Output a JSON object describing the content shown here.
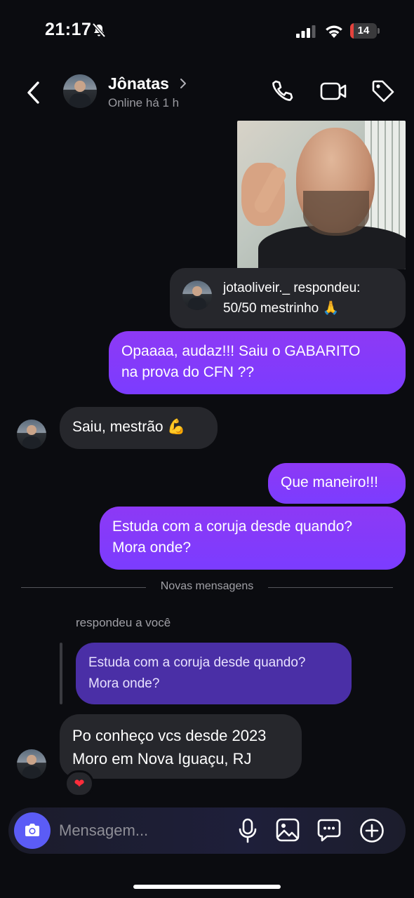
{
  "status_bar": {
    "time": "21:17",
    "battery_level": "14",
    "battery_fraction": 0.14,
    "silent_icon": "bell-slash-icon",
    "signal_icon": "cellular-signal-icon",
    "wifi_icon": "wifi-icon"
  },
  "header": {
    "contact_name": "Jônatas",
    "contact_status": "Online há 1 h",
    "back_icon": "chevron-left-icon",
    "actions": [
      "phone-icon",
      "video-camera-icon",
      "tag-icon"
    ]
  },
  "conversation": {
    "story_reply": {
      "title": "jotaoliveir._ respondeu:",
      "text": "50/50 mestrinho 🙏"
    },
    "messages": [
      {
        "direction": "out",
        "text": "Opaaaa, audaz!!! Saiu o GABARITO\nna prova do CFN ??"
      },
      {
        "direction": "in",
        "text": "Saiu, mestrão 💪"
      },
      {
        "direction": "out",
        "text": "Que maneiro!!!"
      },
      {
        "direction": "out",
        "text": "Estuda com a coruja desde quando?\nMora onde?"
      }
    ],
    "divider_label": "Novas mensagens",
    "reply_context": {
      "label": "respondeu a você",
      "quoted_text": "Estuda com a coruja desde quando?\nMora onde?"
    },
    "last_message": {
      "direction": "in",
      "text": "Po conheço vcs desde 2023\nMoro em Nova Iguaçu, RJ",
      "reaction": "❤"
    }
  },
  "composer": {
    "placeholder": "Mensagem...",
    "icons": [
      "camera-icon",
      "microphone-icon",
      "gallery-icon",
      "sticker-icon",
      "plus-icon"
    ]
  },
  "colors": {
    "background": "#0b0c10",
    "outgoing_bubble": "#7b3cff",
    "incoming_bubble": "#26272c",
    "camera_button": "#5b5cf6",
    "reaction_heart": "#ff2d3b"
  }
}
